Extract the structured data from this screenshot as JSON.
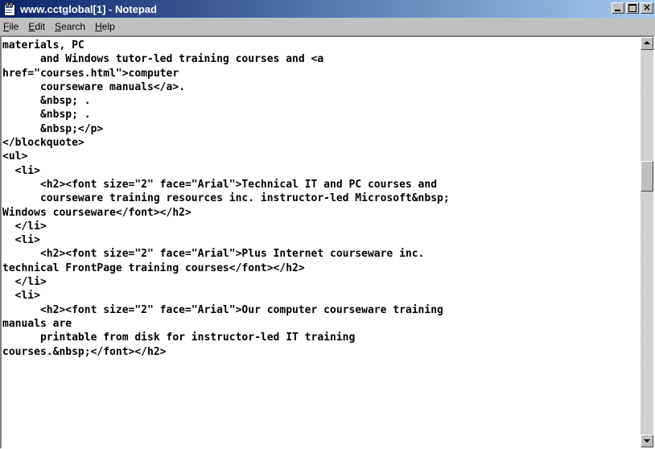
{
  "window": {
    "title": "www.cctglobal[1] - Notepad",
    "icon": "notepad-icon"
  },
  "controls": {
    "minimize": "minimize-icon",
    "maximize": "maximize-icon",
    "close": "close-icon",
    "close_glyph": "×"
  },
  "menu": [
    {
      "pre": "",
      "key": "F",
      "post": "ile"
    },
    {
      "pre": "",
      "key": "E",
      "post": "dit"
    },
    {
      "pre": "",
      "key": "S",
      "post": "earch"
    },
    {
      "pre": "",
      "key": "H",
      "post": "elp"
    }
  ],
  "document": {
    "lines": [
      "materials, PC",
      "      and Windows tutor-led training courses and <a",
      "href=\"courses.html\">computer",
      "      courseware manuals</a>.",
      "      &nbsp; .",
      "      &nbsp; .",
      "      &nbsp;</p>",
      "</blockquote>",
      "<ul>",
      "  <li>",
      "      <h2><font size=\"2\" face=\"Arial\">Technical IT and PC courses and",
      "      courseware training resources inc. instructor-led Microsoft&nbsp;",
      "Windows courseware</font></h2>",
      "  </li>",
      "  <li>",
      "      <h2><font size=\"2\" face=\"Arial\">Plus Internet courseware inc.",
      "technical FrontPage training courses</font></h2>",
      "  </li>",
      "  <li>",
      "      <h2><font size=\"2\" face=\"Arial\">Our computer courseware training",
      "manuals are",
      "      printable from disk for instructor-led IT training",
      "courses.&nbsp;</font></h2>"
    ]
  },
  "scrollbar": {
    "up": "scroll-up-arrow-icon",
    "down": "scroll-down-arrow-icon"
  },
  "colors": {
    "titlebar_start": "#0a246a",
    "titlebar_end": "#a6caf0",
    "chrome": "#c0c0c0"
  }
}
